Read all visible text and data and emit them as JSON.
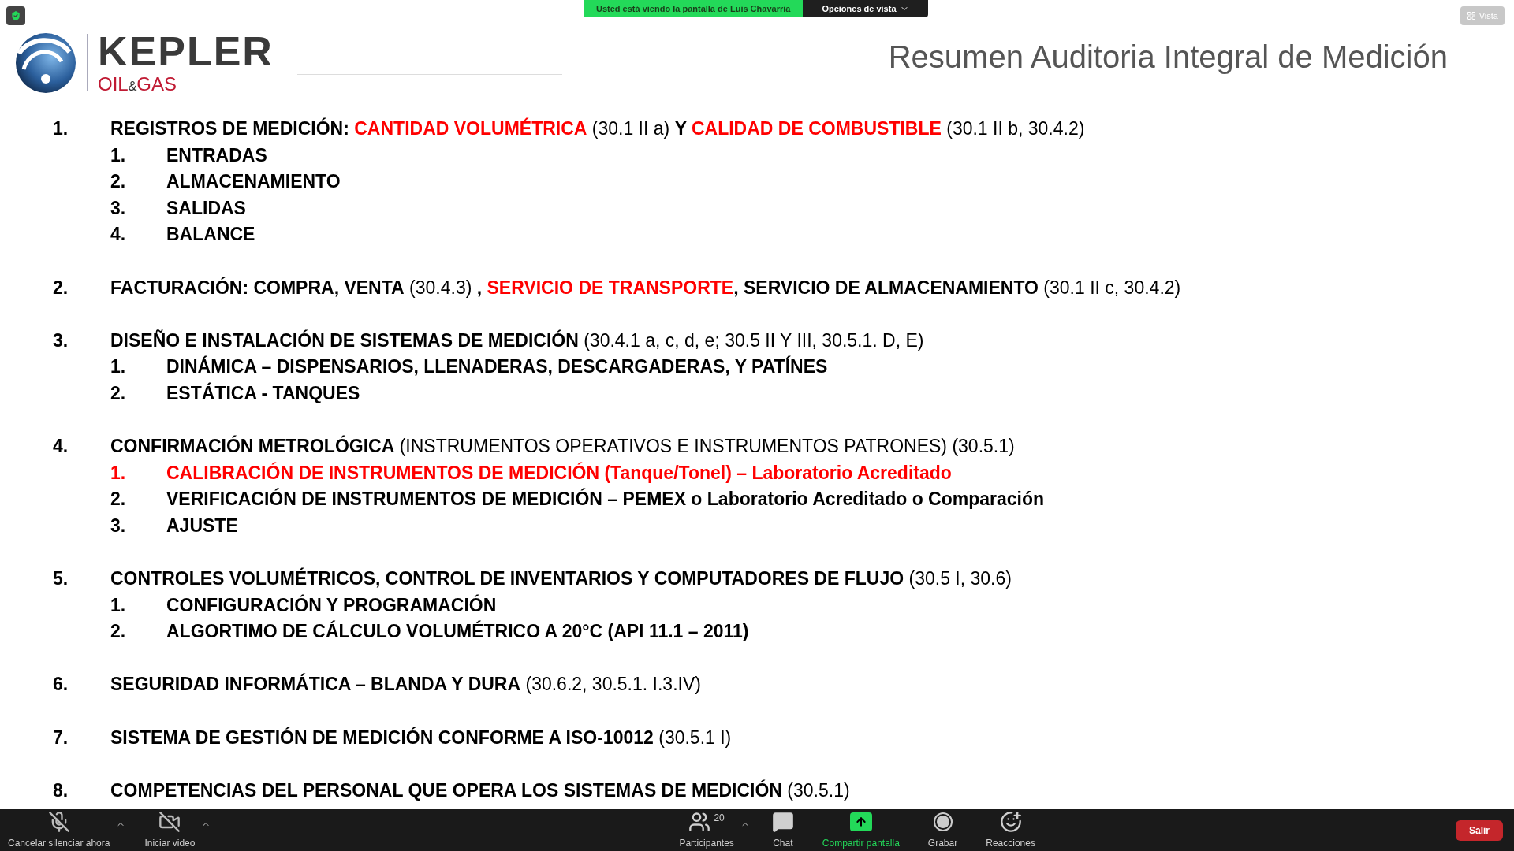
{
  "meeting_banner": {
    "text": "Usted está viendo la pantalla de Luis Chavarria",
    "options": "Opciones de vista"
  },
  "view_button": {
    "label": "Vista"
  },
  "slide": {
    "logo": {
      "name": "KEPLER",
      "tagline_left": "OIL",
      "tagline_amp": "&",
      "tagline_right": "GAS"
    },
    "title": "Resumen Auditoria Integral de Medición",
    "items": [
      {
        "number": "1.",
        "segments": [
          {
            "text": "REGISTROS DE MEDICIÓN: ",
            "kind": "bold"
          },
          {
            "text": "CANTIDAD VOLUMÉTRICA",
            "kind": "highlight"
          },
          {
            "text": " (30.1 II a) ",
            "kind": "plain"
          },
          {
            "text": "Y ",
            "kind": "bold"
          },
          {
            "text": "CALIDAD DE COMBUSTIBLE",
            "kind": "highlight"
          },
          {
            "text": " (30.1 II b, 30.4.2)",
            "kind": "plain"
          }
        ],
        "children": [
          {
            "number": "1.",
            "text": "ENTRADAS",
            "highlight": false
          },
          {
            "number": "2.",
            "text": "ALMACENAMIENTO",
            "highlight": false
          },
          {
            "number": "3.",
            "text": "SALIDAS",
            "highlight": false
          },
          {
            "number": "4.",
            "text": "BALANCE",
            "highlight": false
          }
        ]
      },
      {
        "number": "2.",
        "segments": [
          {
            "text": "FACTURACIÓN: COMPRA, VENTA",
            "kind": "bold"
          },
          {
            "text": " (30.4.3) ",
            "kind": "plain"
          },
          {
            "text": ", ",
            "kind": "bold"
          },
          {
            "text": "SERVICIO DE TRANSPORTE",
            "kind": "highlight"
          },
          {
            "text": ", SERVICIO DE ALMACENAMIENTO",
            "kind": "bold"
          },
          {
            "text": " (30.1 II c, 30.4.2)",
            "kind": "plain"
          }
        ]
      },
      {
        "number": "3.",
        "segments": [
          {
            "text": "DISEÑO E INSTALACIÓN DE SISTEMAS DE MEDICIÓN",
            "kind": "bold"
          },
          {
            "text": " (30.4.1 a, c, d, e; 30.5 II Y III, 30.5.1. D, E)",
            "kind": "plain"
          }
        ],
        "children": [
          {
            "number": "1.",
            "text": "DINÁMICA – DISPENSARIOS, LLENADERAS, DESCARGADERAS, Y PATÍNES",
            "highlight": false
          },
          {
            "number": "2.",
            "text": "ESTÁTICA - TANQUES",
            "highlight": false
          }
        ]
      },
      {
        "number": "4.",
        "segments": [
          {
            "text": "CONFIRMACIÓN METROLÓGICA",
            "kind": "bold"
          },
          {
            "text": " (INSTRUMENTOS OPERATIVOS E INSTRUMENTOS PATRONES) (30.5.1)",
            "kind": "plain"
          }
        ],
        "children": [
          {
            "number": "1.",
            "text": "CALIBRACIÓN DE INSTRUMENTOS DE MEDICIÓN (Tanque/Tonel) – Laboratorio Acreditado",
            "highlight": true
          },
          {
            "number": "2.",
            "text": "VERIFICACIÓN DE INSTRUMENTOS DE MEDICIÓN – PEMEX o Laboratorio Acreditado o Comparación",
            "highlight": false
          },
          {
            "number": "3.",
            "text": "AJUSTE",
            "highlight": false
          }
        ]
      },
      {
        "number": "5.",
        "segments": [
          {
            "text": "CONTROLES VOLUMÉTRICOS, CONTROL DE INVENTARIOS Y COMPUTADORES DE FLUJO",
            "kind": "bold"
          },
          {
            "text": " (30.5 I, 30.6)",
            "kind": "plain"
          }
        ],
        "children": [
          {
            "number": "1.",
            "text": "CONFIGURACIÓN Y PROGRAMACIÓN",
            "highlight": false
          },
          {
            "number": "2.",
            "text": "ALGORTIMO DE CÁLCULO VOLUMÉTRICO A 20°C (API 11.1 – 2011)",
            "highlight": false
          }
        ]
      },
      {
        "number": "6.",
        "segments": [
          {
            "text": "SEGURIDAD INFORMÁTICA – BLANDA Y DURA",
            "kind": "bold"
          },
          {
            "text": " (30.6.2, 30.5.1. I.3.IV)",
            "kind": "plain"
          }
        ]
      },
      {
        "number": "7.",
        "segments": [
          {
            "text": "SISTEMA DE GESTIÓN DE MEDICIÓN CONFORME A ISO-10012",
            "kind": "bold"
          },
          {
            "text": " (30.5.1 I)",
            "kind": "plain"
          }
        ]
      },
      {
        "number": "8.",
        "segments": [
          {
            "text": "COMPETENCIAS DEL PERSONAL QUE OPERA LOS SISTEMAS DE MEDICIÓN",
            "kind": "bold"
          },
          {
            "text": " (30.5.1)",
            "kind": "plain"
          }
        ]
      }
    ]
  },
  "toolbar": {
    "left": [
      {
        "kind": "mic-off",
        "label": "Cancelar silenciar ahora",
        "caret": true
      },
      {
        "kind": "video-off",
        "label": "Iniciar video",
        "caret": true
      }
    ],
    "center": [
      {
        "kind": "participants",
        "label": "Participantes",
        "count": "20",
        "caret": true,
        "active": false
      },
      {
        "kind": "chat",
        "label": "Chat",
        "caret": false,
        "active": false
      },
      {
        "kind": "share",
        "label": "Compartir pantalla",
        "caret": false,
        "active": true
      },
      {
        "kind": "record",
        "label": "Grabar",
        "caret": false,
        "active": false
      },
      {
        "kind": "reactions",
        "label": "Reacciones",
        "caret": false,
        "active": false
      }
    ],
    "leave": "Salir"
  }
}
